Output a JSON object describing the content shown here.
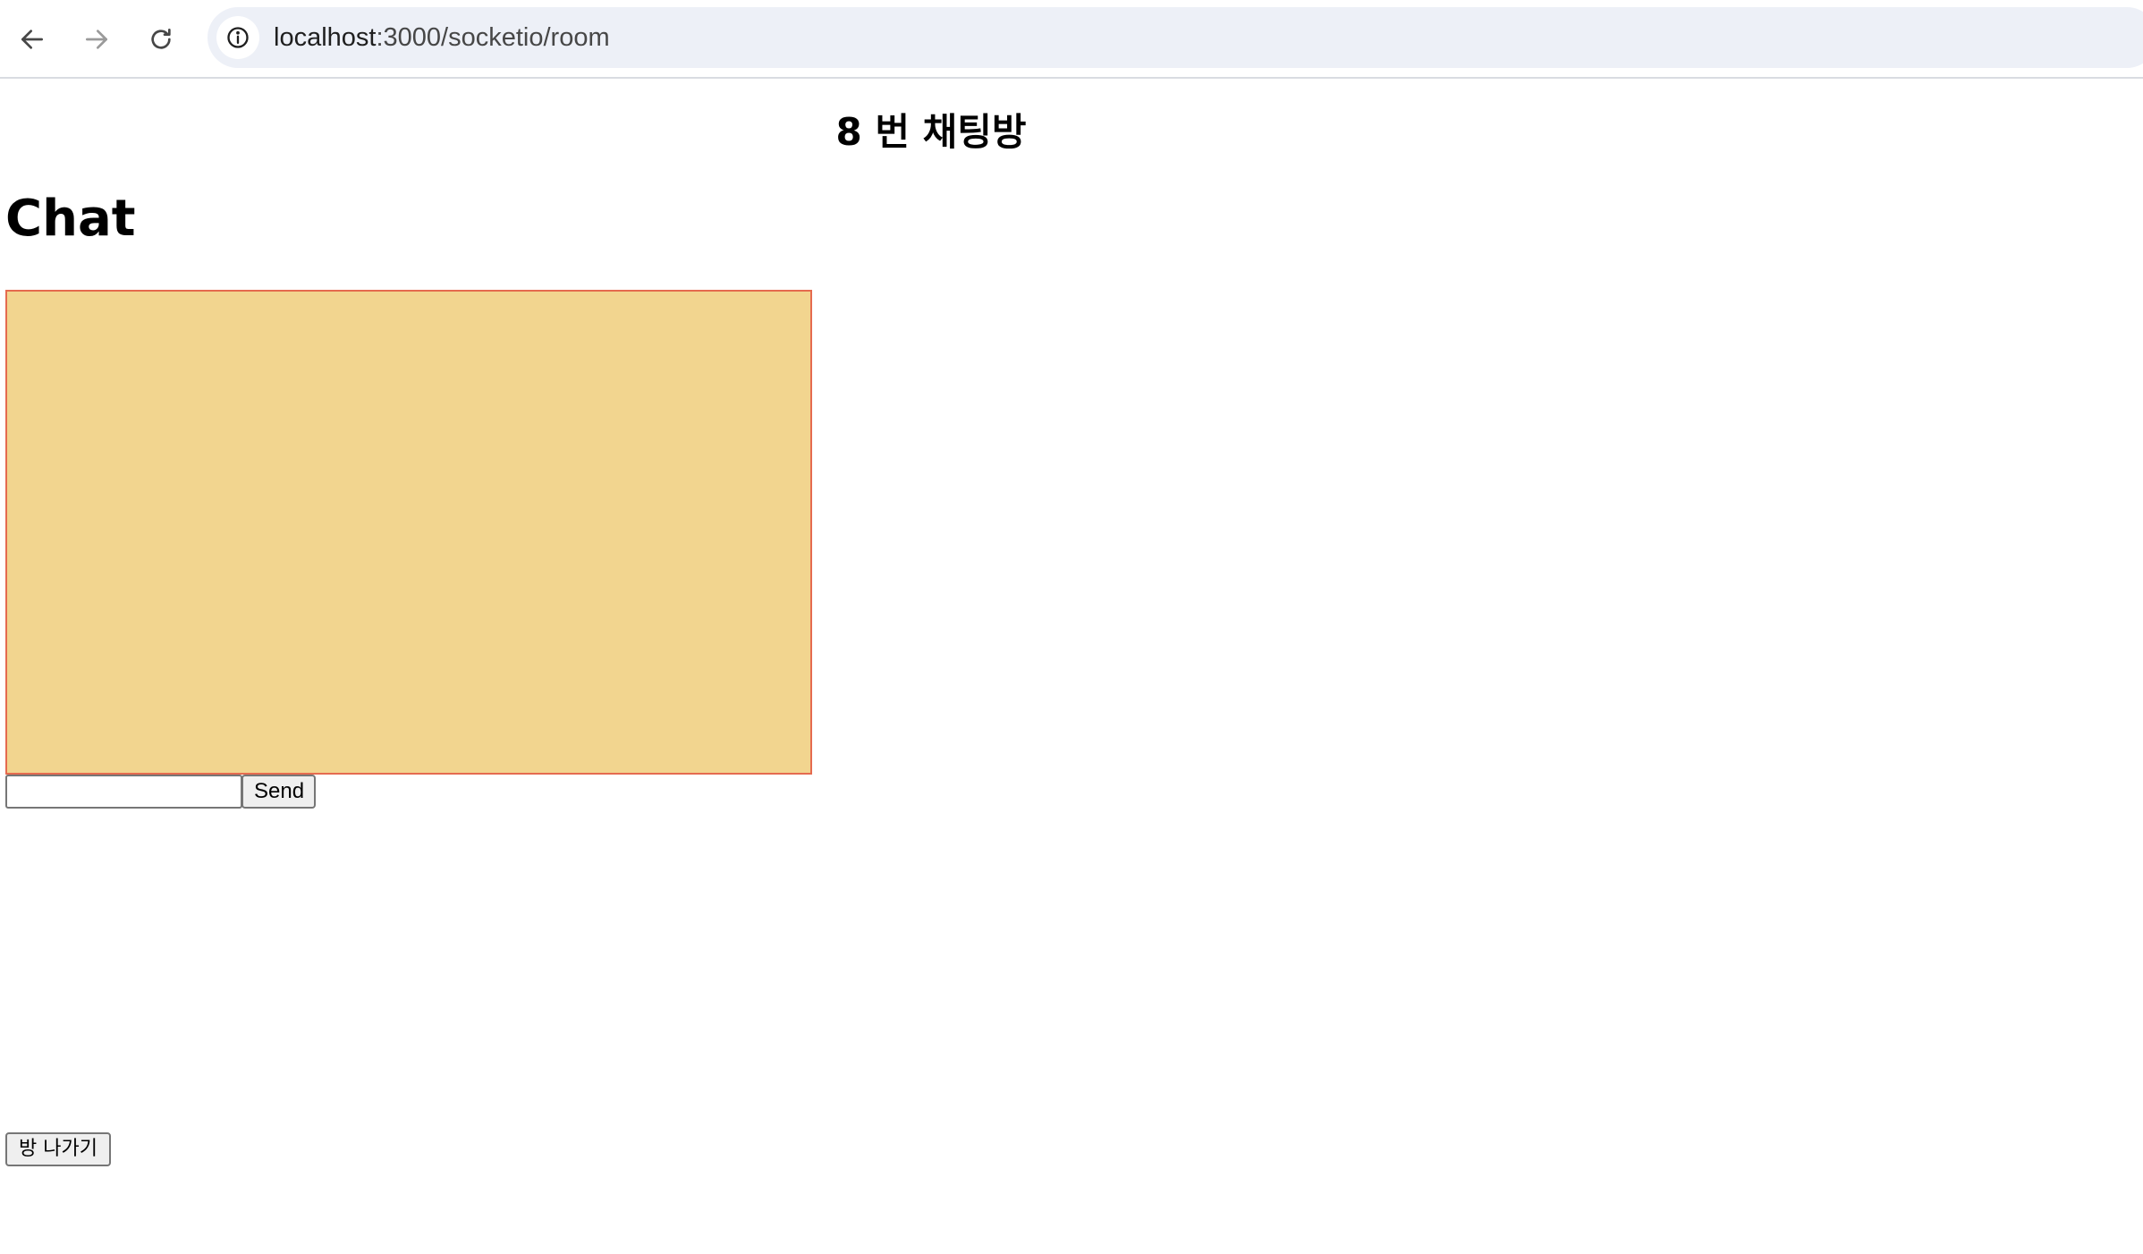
{
  "browser": {
    "url_host": "localhost",
    "url_path": ":3000/socketio/room"
  },
  "page": {
    "room_title": "8 번 채팅방",
    "chat_heading": "Chat",
    "message_input": {
      "value": "",
      "placeholder": ""
    },
    "send_label": "Send",
    "leave_label": "방 나가기"
  },
  "colors": {
    "chat_log_bg": "#f2d58f",
    "chat_log_border": "#e56b4f"
  }
}
